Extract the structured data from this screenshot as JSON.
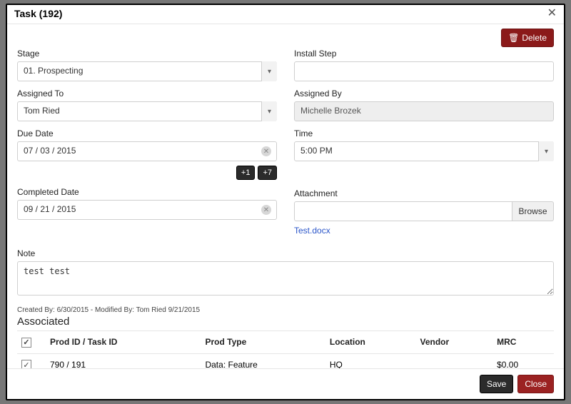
{
  "header": {
    "title": "Task (192)"
  },
  "buttons": {
    "delete": "Delete",
    "save": "Save",
    "close": "Close",
    "browse": "Browse",
    "plus1": "+1",
    "plus7": "+7"
  },
  "labels": {
    "stage": "Stage",
    "install_step": "Install Step",
    "assigned_to": "Assigned To",
    "assigned_by": "Assigned By",
    "due_date": "Due Date",
    "time": "Time",
    "completed_date": "Completed Date",
    "attachment": "Attachment",
    "note": "Note",
    "associated": "Associated"
  },
  "values": {
    "stage": "01. Prospecting",
    "install_step": "",
    "assigned_to": "Tom Ried",
    "assigned_by": "Michelle Brozek",
    "due_date": "07 / 03 / 2015",
    "time": "5:00 PM",
    "completed_date": "09 / 21 / 2015",
    "attachment_filename": "Test.docx",
    "note": "test test"
  },
  "meta": "Created By: 6/30/2015 - Modified By: Tom Ried 9/21/2015",
  "table": {
    "headers": {
      "checkbox": "",
      "prod_task": "Prod ID / Task ID",
      "prod_type": "Prod Type",
      "location": "Location",
      "vendor": "Vendor",
      "mrc": "MRC"
    },
    "rows": [
      {
        "checked": true,
        "prod_task": "790 / 191",
        "prod_type": "Data: Feature",
        "location": "HQ",
        "vendor": "",
        "mrc": "$0.00"
      }
    ]
  }
}
